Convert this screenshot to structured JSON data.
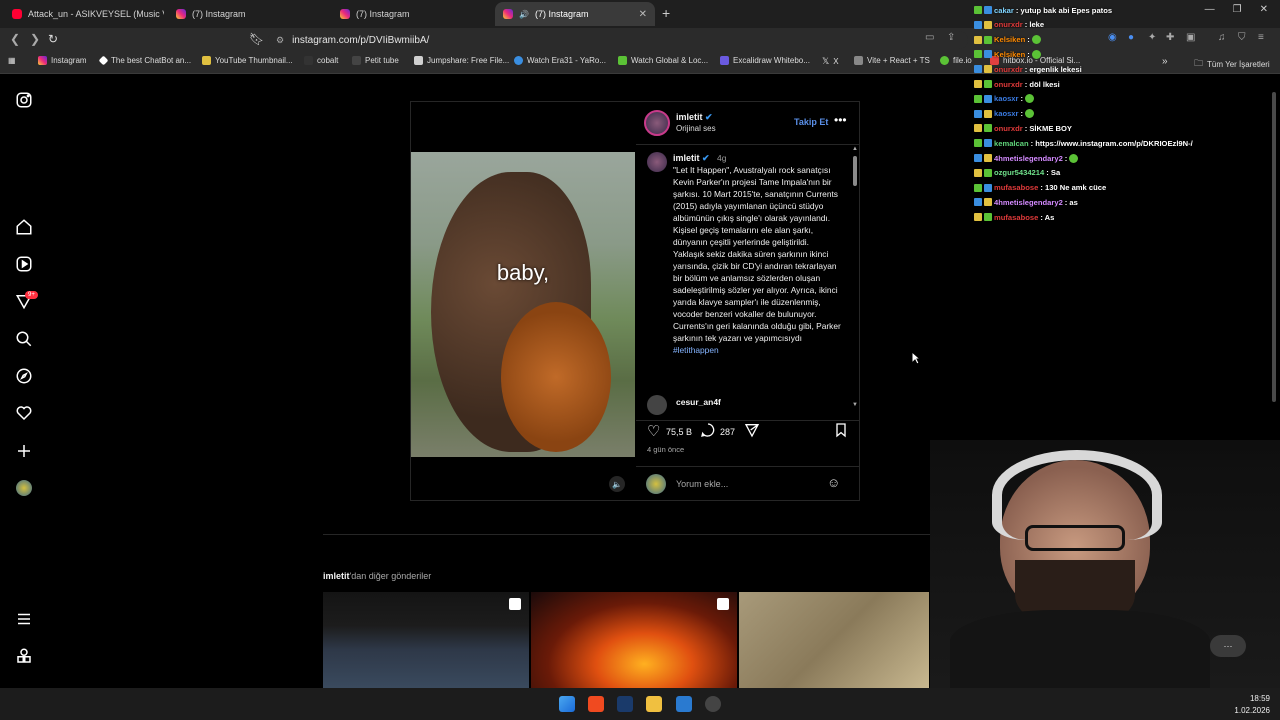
{
  "browser": {
    "tabs": [
      {
        "title": "Attack_un - ASIKVEYSEL (Music Video)",
        "active": false,
        "icon": "youtube-icon"
      },
      {
        "title": "(7) Instagram",
        "active": false,
        "icon": "instagram-icon"
      },
      {
        "title": "(7) Instagram",
        "active": false,
        "icon": "instagram-icon"
      },
      {
        "title": "(7) Instagram",
        "active": true,
        "icon": "instagram-icon"
      }
    ],
    "url": "instagram.com/p/DVIiBwmiibA/",
    "bookmarks": [
      "Instagram",
      "The best ChatBot an...",
      "YouTube Thumbnail...",
      "cobalt",
      "Petit tube",
      "Jumpshare: Free File...",
      "Watch Era31 - YaRo...",
      "Watch Global & Loc...",
      "Excalidraw Whitebo...",
      "X",
      "Vite + React + TS",
      "file.io",
      "hitbox.io - Official Si..."
    ],
    "all_bookmarks": "Tüm Yer İşaretleri"
  },
  "post": {
    "username": "imletit",
    "subtitle": "Orijinal ses",
    "follow_label": "Takip Et",
    "time": "4g",
    "video_caption": "baby,",
    "description": "\"Let It Happen\", Avustralyalı rock sanatçısı Kevin Parker'ın projesi Tame Impala'nın bir şarkısı. 10 Mart 2015'te, sanatçının Currents (2015) adıyla yayımlanan üçüncü stüdyo albümünün çıkış single'ı olarak yayınlandı. Kişisel geçiş temalarını ele alan şarkı, dünyanın çeşitli yerlerinde geliştirildi. Yaklaşık sekiz dakika süren şarkının ikinci yarısında, çizik bir CD'yi andıran tekrarlayan bir bölüm ve anlamsız sözlerden oluşan sadeleştirilmiş sözler yer alıyor. Ayrıca, ikinci yarıda klavye sampler'ı ile düzenlenmiş, vocoder benzeri vokaller de bulunuyor. Currents'ın geri kalanında olduğu gibi, Parker şarkının tek yazarı ve yapımcısıydı",
    "hashtag": "#letithappen",
    "first_comment_user": "cesur_an4f",
    "likes": "75,5 B",
    "comments": "287",
    "posted": "4 gün önce",
    "comment_placeholder": "Yorum ekle..."
  },
  "more_posts": {
    "label_user": "imletit",
    "label_rest": "'dan diğer gönderiler"
  },
  "sidebar": {
    "notification_badge": "9+"
  },
  "chat": [
    {
      "user": "cakar",
      "color": "#7fd4ff",
      "text": ": yutup bak abi Epes patos"
    },
    {
      "user": "onurxdr",
      "color": "#e03a3a",
      "text": ": leke"
    },
    {
      "user": "Kelsiken",
      "color": "#ff8a00",
      "text": ":"
    },
    {
      "user": "Kelsiken",
      "color": "#ff8a00",
      "text": ":"
    },
    {
      "user": "onurxdr",
      "color": "#e03a3a",
      "text": ": ergenlik lekesi"
    },
    {
      "user": "onurxdr",
      "color": "#e03a3a",
      "text": ": döl lkesi"
    },
    {
      "user": "kaosxr",
      "color": "#3a7ae0",
      "text": ":"
    },
    {
      "user": "kaosxr",
      "color": "#3a7ae0",
      "text": ":"
    },
    {
      "user": "onurxdr",
      "color": "#e03a3a",
      "text": ": SİKME BOY"
    },
    {
      "user": "kemalcan",
      "color": "#5fd47a",
      "text": ": https://www.instagram.com/p/DKRIOEzl9N-/"
    },
    {
      "user": "4hmetislegendary2",
      "color": "#d48aff",
      "text": ":"
    },
    {
      "user": "ozgur5434214",
      "color": "#6fe08a",
      "text": ": Sa"
    },
    {
      "user": "mufasabose",
      "color": "#e03a3a",
      "text": ": 130 Ne amk cüce"
    },
    {
      "user": "4hmetislegendary2",
      "color": "#d48aff",
      "text": ": as"
    },
    {
      "user": "mufasabose",
      "color": "#e03a3a",
      "text": ": As"
    }
  ],
  "taskbar": {
    "time": "18:59",
    "date": "1.02.2026"
  }
}
